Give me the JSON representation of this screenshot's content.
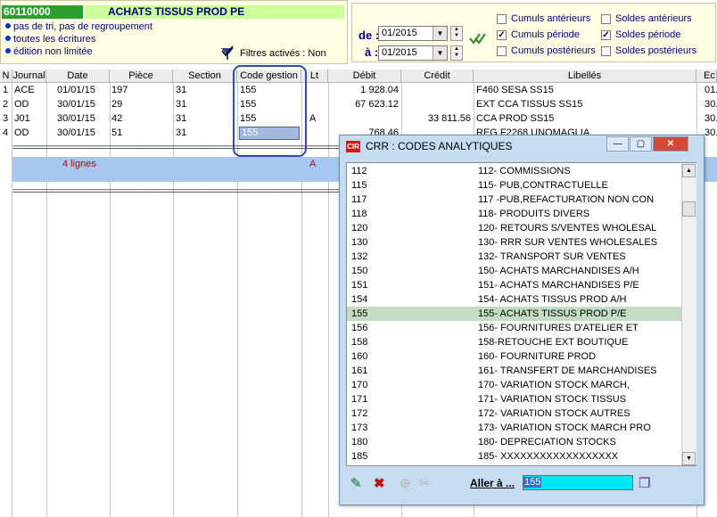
{
  "account": {
    "code": "60110000",
    "name": "ACHATS TISSUS PROD PE",
    "options": [
      "pas de tri, pas de regroupement",
      "toutes les écritures",
      "édition non limitée"
    ],
    "filters_label": "Filtres activés : Non"
  },
  "period": {
    "from_label": "de :",
    "to_label": "à :",
    "from_value": "01/2015",
    "to_value": "01/2015",
    "checkboxes": [
      {
        "label": "Cumuls antérieurs",
        "checked": false
      },
      {
        "label": "Cumuls période",
        "checked": true
      },
      {
        "label": "Cumuls postérieurs",
        "checked": false
      },
      {
        "label": "Soldes antérieurs",
        "checked": false
      },
      {
        "label": "Soldes période",
        "checked": true
      },
      {
        "label": "Soldes postérieurs",
        "checked": false
      }
    ]
  },
  "grid": {
    "columns": [
      "N",
      "Journal",
      "Date",
      "Pièce",
      "Section",
      "Code gestion",
      "Lt",
      "Débit",
      "Crédit",
      "Libellés",
      "Ec"
    ],
    "rows": [
      {
        "n": "1",
        "journal": "ACE",
        "date": "01/01/15",
        "piece": "197",
        "section": "31",
        "code": "155",
        "lt": "",
        "debit": "1 928.04",
        "credit": "",
        "libelle": "F460 SESA SS15",
        "ec": "01."
      },
      {
        "n": "2",
        "journal": "OD",
        "date": "30/01/15",
        "piece": "29",
        "section": "31",
        "code": "155",
        "lt": "",
        "debit": "67 623.12",
        "credit": "",
        "libelle": "EXT CCA TISSUS SS15",
        "ec": "30."
      },
      {
        "n": "3",
        "journal": "J01",
        "date": "30/01/15",
        "piece": "42",
        "section": "31",
        "code": "155",
        "lt": "A",
        "debit": "",
        "credit": "33 811.56",
        "libelle": "CCA  PROD SS15",
        "ec": "30."
      },
      {
        "n": "4",
        "journal": "OD",
        "date": "30/01/15",
        "piece": "51",
        "section": "31",
        "code": "155",
        "lt": "",
        "debit": "768.46",
        "credit": "",
        "libelle": "REG F2268 UNOMAGLIA",
        "ec": "30."
      }
    ],
    "summary": {
      "count_label": "4 lignes",
      "lt": "A"
    }
  },
  "modal": {
    "title": "CRR    : CODES ANALYTIQUES",
    "logo": "CIR",
    "items": [
      {
        "code": "112",
        "label": "112- COMMISSIONS"
      },
      {
        "code": "115",
        "label": "115- PUB,CONTRACTUELLE"
      },
      {
        "code": "117",
        "label": "117 -PUB,REFACTURATION NON CON"
      },
      {
        "code": "118",
        "label": "118- PRODUITS DIVERS"
      },
      {
        "code": "120",
        "label": "120- RETOURS S/VENTES WHOLESAL"
      },
      {
        "code": "130",
        "label": "130- RRR SUR VENTES WHOLESALES"
      },
      {
        "code": "132",
        "label": "132- TRANSPORT SUR VENTES"
      },
      {
        "code": "150",
        "label": "150- ACHATS MARCHANDISES A/H"
      },
      {
        "code": "151",
        "label": "151- ACHATS MARCHANDISES P/E"
      },
      {
        "code": "154",
        "label": "154- ACHATS TISSUS PROD A/H"
      },
      {
        "code": "155",
        "label": "155- ACHATS TISSUS PROD P/E"
      },
      {
        "code": "156",
        "label": "156- FOURNITURES D'ATELIER ET"
      },
      {
        "code": "158",
        "label": "158-RETOUCHE EXT BOUTIQUE"
      },
      {
        "code": "160",
        "label": "160- FOURNITURE PROD"
      },
      {
        "code": "161",
        "label": "161- TRANSFERT DE MARCHANDISES"
      },
      {
        "code": "170",
        "label": "170- VARIATION STOCK MARCH,"
      },
      {
        "code": "171",
        "label": "171- VARIATION STOCK TISSUS"
      },
      {
        "code": "172",
        "label": "172- VARIATION STOCK AUTRES"
      },
      {
        "code": "173",
        "label": "173- VARIATION STOCK MARCH PRO"
      },
      {
        "code": "180",
        "label": "180- DEPRECIATION STOCKS"
      },
      {
        "code": "185",
        "label": "185- XXXXXXXXXXXXXXXXXX"
      }
    ],
    "selected_code": "155",
    "goto_label": "Aller à ...",
    "goto_value": "155"
  },
  "colors": {
    "selection": "#c4dcc4",
    "band": "#a6c8f0",
    "code_header": "#2e9e2e",
    "title_bg": "#ccff99"
  }
}
